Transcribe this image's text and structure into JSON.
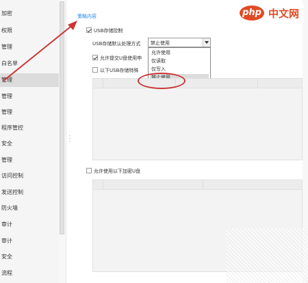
{
  "sidebar": {
    "items": [
      {
        "label": "加密"
      },
      {
        "label": "权限"
      },
      {
        "label": "管理"
      },
      {
        "label": "白名单"
      },
      {
        "label": "管理"
      },
      {
        "label": "管理"
      },
      {
        "label": "管理"
      },
      {
        "label": "程序管控"
      },
      {
        "label": "安全"
      },
      {
        "label": "管理"
      },
      {
        "label": "访问控制"
      },
      {
        "label": "发送控制"
      },
      {
        "label": "防火墙"
      },
      {
        "label": "审计"
      },
      {
        "label": "审计"
      },
      {
        "label": "安全"
      },
      {
        "label": "流程"
      }
    ],
    "selected_index": 4
  },
  "main": {
    "section_title": "策略内容",
    "usb_control_label": "USB存储控制",
    "default_mode_label": "USB存储默认处理方式",
    "default_mode_value": "禁止使用",
    "dropdown_options": [
      "允许使用",
      "仅读取",
      "仅写入",
      "禁止使用"
    ],
    "allow_submit_label": "允许提交U盘使用申",
    "following_usb_label": "以下USB存储特殊",
    "allow_encrypted_label": "允许使用以下加密U盘"
  },
  "watermark": {
    "logo": "php",
    "text": "中文网"
  },
  "colors": {
    "accent": "#1e88e5",
    "annotation": "#cc3333",
    "watermark": "#e14a24"
  }
}
